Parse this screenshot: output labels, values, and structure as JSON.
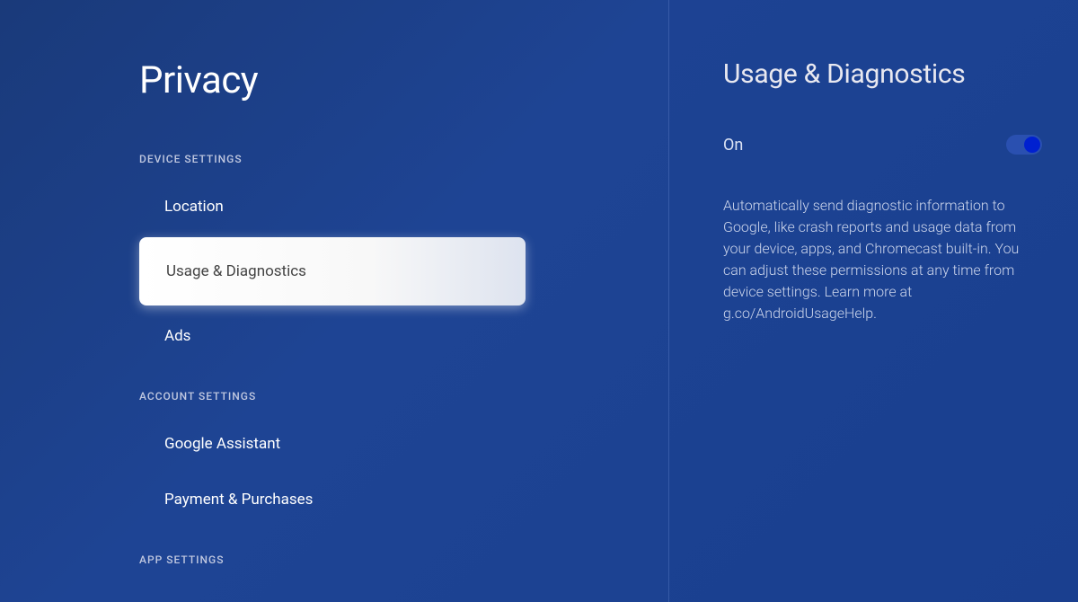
{
  "left": {
    "title": "Privacy",
    "sections": [
      {
        "header": "DEVICE SETTINGS",
        "items": [
          {
            "label": "Location",
            "selected": false
          },
          {
            "label": "Usage & Diagnostics",
            "selected": true
          },
          {
            "label": "Ads",
            "selected": false
          }
        ]
      },
      {
        "header": "ACCOUNT SETTINGS",
        "items": [
          {
            "label": "Google Assistant",
            "selected": false
          },
          {
            "label": "Payment & Purchases",
            "selected": false
          }
        ]
      },
      {
        "header": "APP SETTINGS",
        "items": []
      }
    ]
  },
  "right": {
    "title": "Usage & Diagnostics",
    "toggle_label": "On",
    "toggle_state": true,
    "description": "Automatically send diagnostic information to Google, like crash reports and usage data from your device, apps, and Chromecast built-in. You can adjust these permissions at any time from device settings. Learn more at g.co/AndroidUsageHelp."
  }
}
